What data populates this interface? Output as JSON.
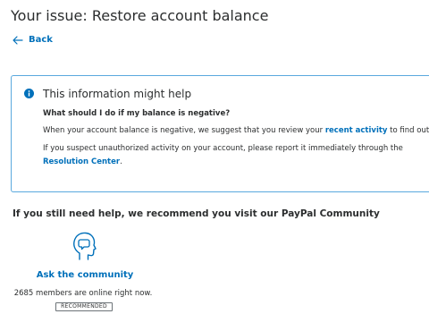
{
  "page": {
    "title": "Your issue: Restore account balance",
    "back_label": "Back"
  },
  "info_card": {
    "heading": "This information might help",
    "question": "What should I do if my balance is negative?",
    "para1_before": "When your account balance is negative, we suggest that you review your ",
    "para1_link": "recent activity",
    "para1_after": " to find out why.",
    "para2_before": "If you suspect unauthorized activity on your account, please report it immediately through the ",
    "para2_link": "Resolution Center",
    "para2_after": "."
  },
  "community": {
    "heading": "If you still need help, we recommend you visit our PayPal Community",
    "link_label": "Ask the community",
    "members_text": "2685 members are online right now.",
    "badge": "RECOMMENDED"
  },
  "icons": {
    "back": "arrow-left-icon",
    "info": "info-circle-icon",
    "community": "head-speech-icon"
  },
  "colors": {
    "link": "#0070ba",
    "card_border": "#5aa9de",
    "text": "#2c2e2f"
  }
}
